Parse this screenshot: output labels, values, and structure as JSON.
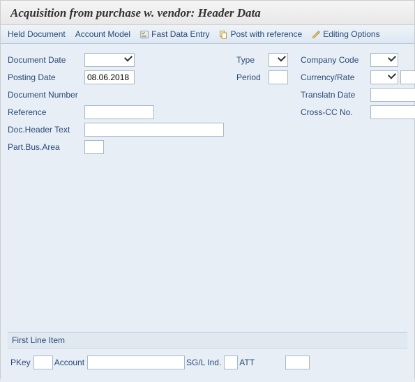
{
  "title": "Acquisition from purchase w. vendor: Header Data",
  "toolbar": {
    "held_document": "Held Document",
    "account_model": "Account Model",
    "fast_data_entry": "Fast Data Entry",
    "post_with_reference": "Post with reference",
    "editing_options": "Editing Options"
  },
  "fields": {
    "document_date": {
      "label": "Document Date",
      "value": ""
    },
    "posting_date": {
      "label": "Posting Date",
      "value": "08.06.2018"
    },
    "document_number": {
      "label": "Document Number",
      "value": ""
    },
    "reference": {
      "label": "Reference",
      "value": ""
    },
    "doc_header_text": {
      "label": "Doc.Header Text",
      "value": ""
    },
    "part_bus_area": {
      "label": "Part.Bus.Area",
      "value": ""
    },
    "type": {
      "label": "Type",
      "value": ""
    },
    "period": {
      "label": "Period",
      "value": ""
    },
    "company_code": {
      "label": "Company Code",
      "value": ""
    },
    "currency_rate": {
      "label": "Currency/Rate",
      "value": ""
    },
    "translatn_date": {
      "label": "Translatn Date",
      "value": ""
    },
    "cross_cc_no": {
      "label": "Cross-CC No.",
      "value": ""
    }
  },
  "first_line_item": {
    "group_title": "First Line Item",
    "pkey": {
      "label": "PKey",
      "value": ""
    },
    "account": {
      "label": "Account",
      "value": ""
    },
    "sgl_ind": {
      "label": "SG/L Ind.",
      "value": ""
    },
    "att": {
      "label": "ATT",
      "value": ""
    }
  }
}
